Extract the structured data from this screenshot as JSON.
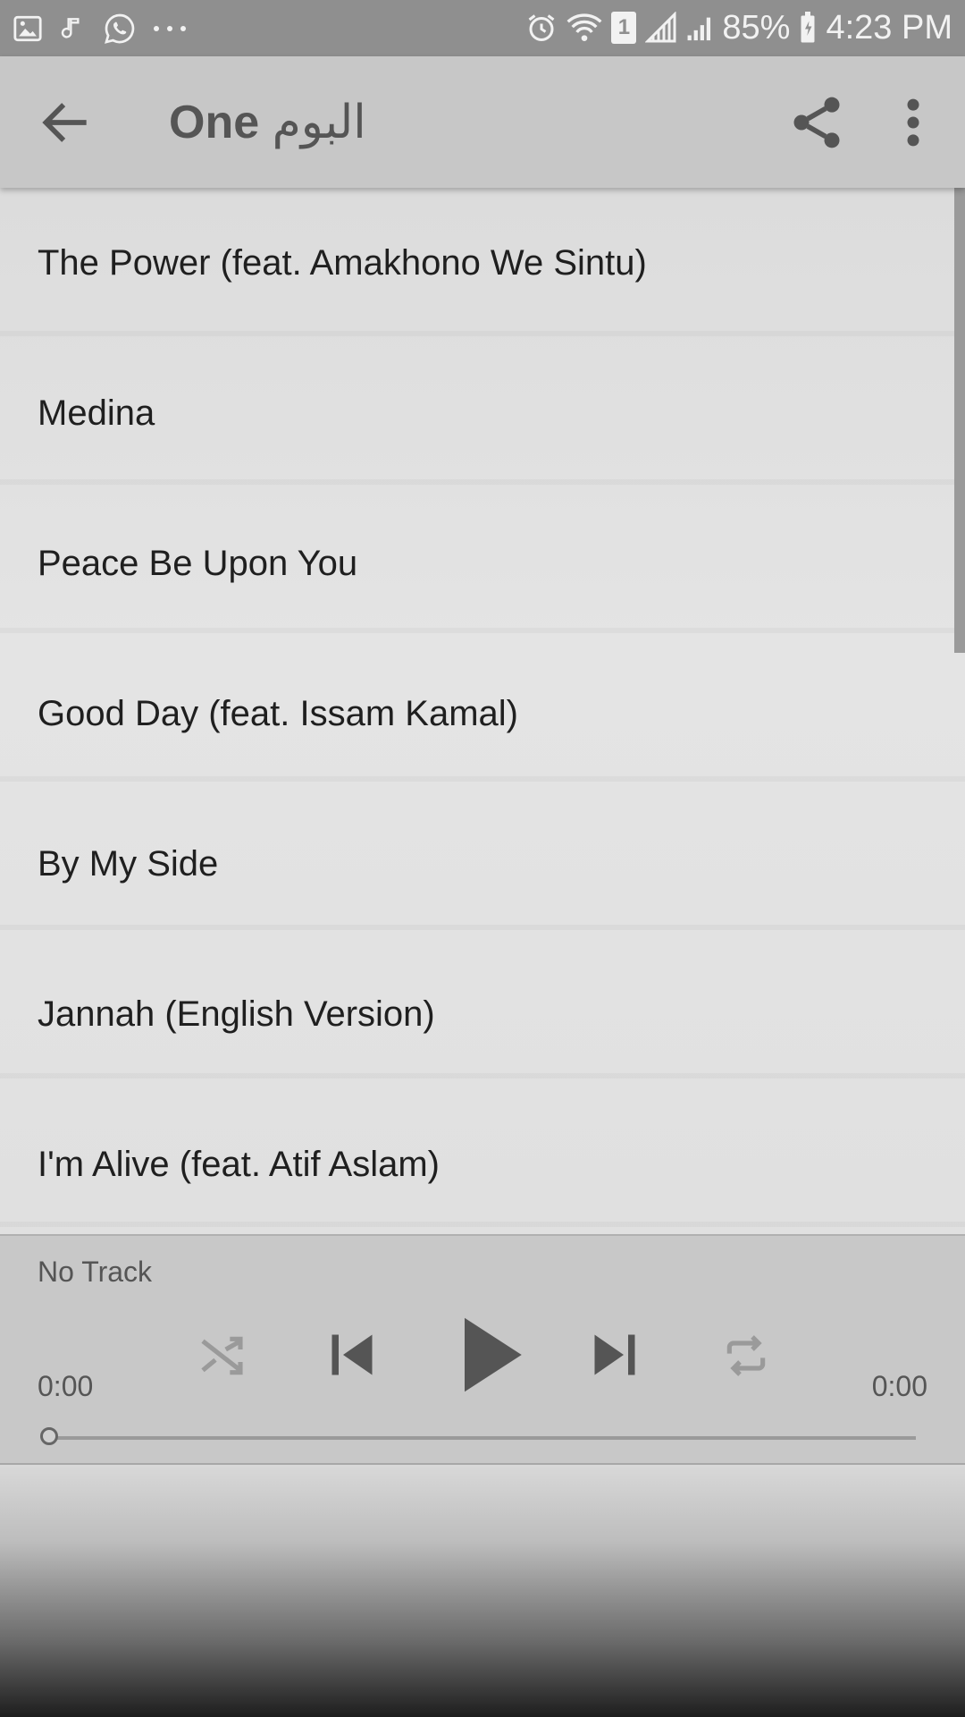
{
  "status_bar": {
    "left_icons": [
      "gallery-icon",
      "music-note-icon",
      "whatsapp-icon",
      "more-dots-icon"
    ],
    "right_icons": [
      "alarm-icon",
      "wifi-icon",
      "sim-1-icon",
      "signal-icon",
      "signal-icon-2",
      "battery-charging-icon"
    ],
    "sim_label": "1",
    "battery_percent": "85%",
    "time": "4:23 PM"
  },
  "app_bar": {
    "title_bold": "One",
    "title_arabic": "البوم",
    "icons": {
      "back": "arrow-left-icon",
      "share": "share-icon",
      "more": "more-vertical-icon"
    }
  },
  "tracks": [
    {
      "title": "The Power (feat. Amakhono We Sintu)"
    },
    {
      "title": "Medina"
    },
    {
      "title": "Peace Be Upon You"
    },
    {
      "title": "Good Day (feat. Issam Kamal)"
    },
    {
      "title": "By My Side"
    },
    {
      "title": "Jannah (English Version)"
    },
    {
      "title": "I'm Alive (feat. Atif Aslam)"
    }
  ],
  "player": {
    "now_playing": "No Track",
    "elapsed": "0:00",
    "total": "0:00",
    "progress": 0,
    "controls": [
      "shuffle-icon",
      "skip-previous-icon",
      "play-icon",
      "skip-next-icon",
      "repeat-icon"
    ]
  },
  "colors": {
    "status_bar_bg": "#8f8f8f",
    "app_bar_bg": "#c7c7c7",
    "player_bg": "#c8c8c8",
    "icon_dark": "#555555",
    "icon_disabled": "#9a9a9a"
  }
}
